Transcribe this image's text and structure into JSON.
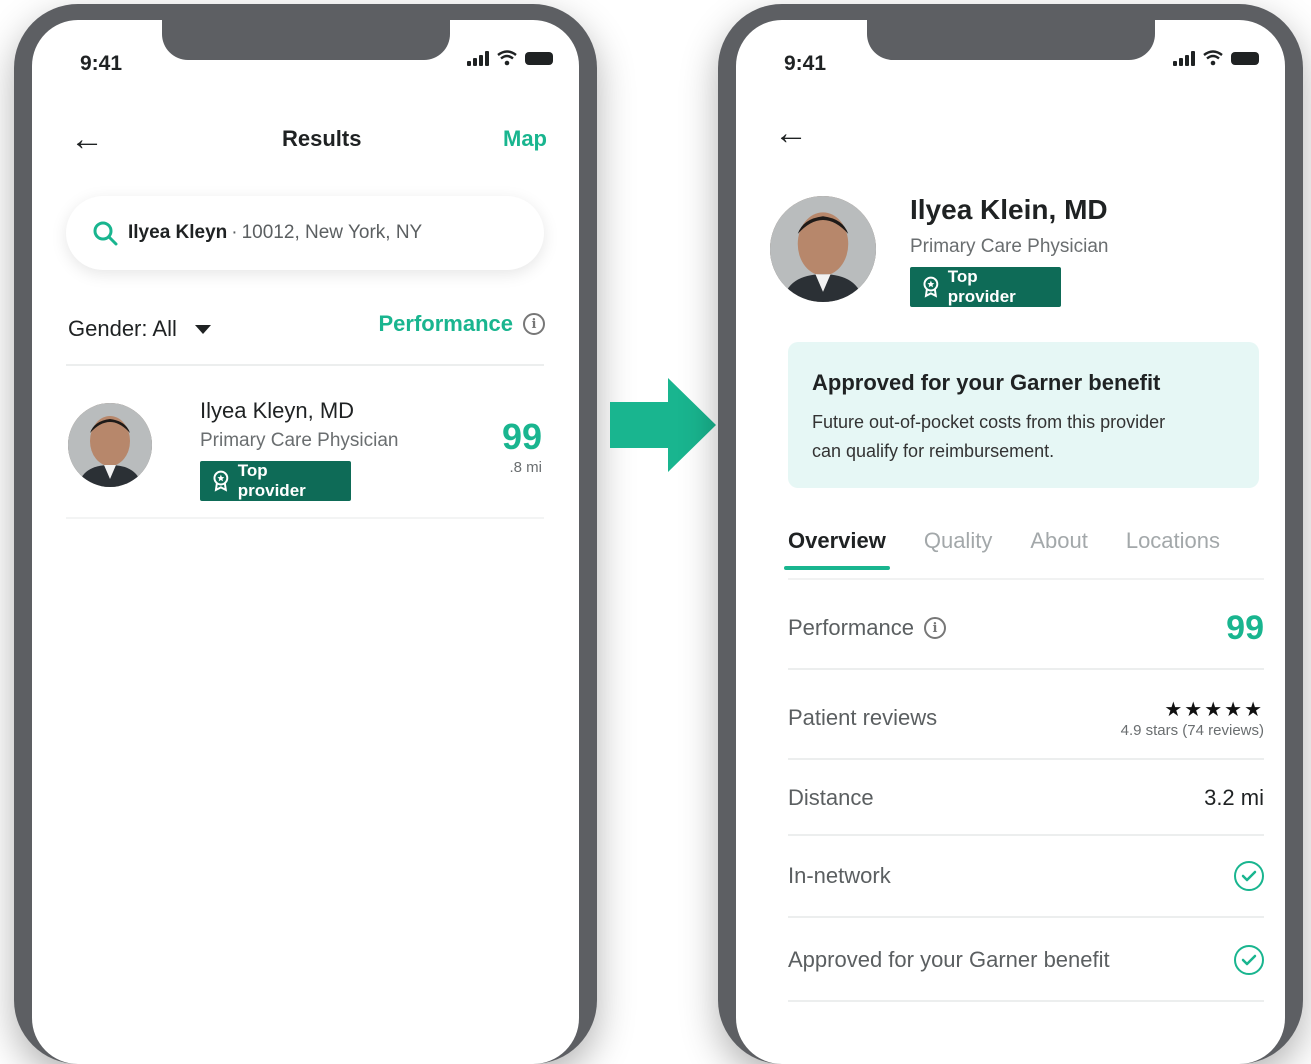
{
  "colors": {
    "accent": "#19b58f",
    "badge": "#0e6b57",
    "benefit_bg": "#e6f7f5"
  },
  "left": {
    "status": {
      "time": "9:41"
    },
    "nav": {
      "back_icon": "back-arrow-icon",
      "title": "Results",
      "map": "Map"
    },
    "search": {
      "query": "Ilyea Kleyn",
      "separator": "·",
      "location": "10012, New York, NY"
    },
    "filter": {
      "gender": "Gender: All",
      "performance": "Performance"
    },
    "result": {
      "name": "Ilyea Kleyn, MD",
      "specialty": "Primary Care Physician",
      "badge": "Top provider",
      "score": "99",
      "distance": ".8 mi"
    }
  },
  "right": {
    "status": {
      "time": "9:41"
    },
    "nav": {
      "back_icon": "back-arrow-icon"
    },
    "provider": {
      "name": "Ilyea Klein, MD",
      "specialty": "Primary Care Physician",
      "badge": "Top provider"
    },
    "benefit": {
      "title": "Approved for your Garner benefit",
      "body_line1": "Future out-of-pocket costs from this provider",
      "body_line2": "can qualify for reimbursement."
    },
    "tabs": [
      "Overview",
      "Quality",
      "About",
      "Locations"
    ],
    "rows": {
      "performance_label": "Performance",
      "performance_value": "99",
      "reviews_label": "Patient reviews",
      "stars": "★★★★★",
      "reviews_sub": "4.9 stars (74 reviews)",
      "distance_label": "Distance",
      "distance_value": "3.2 mi",
      "network_label": "In-network",
      "garner_label": "Approved for your Garner benefit"
    }
  }
}
